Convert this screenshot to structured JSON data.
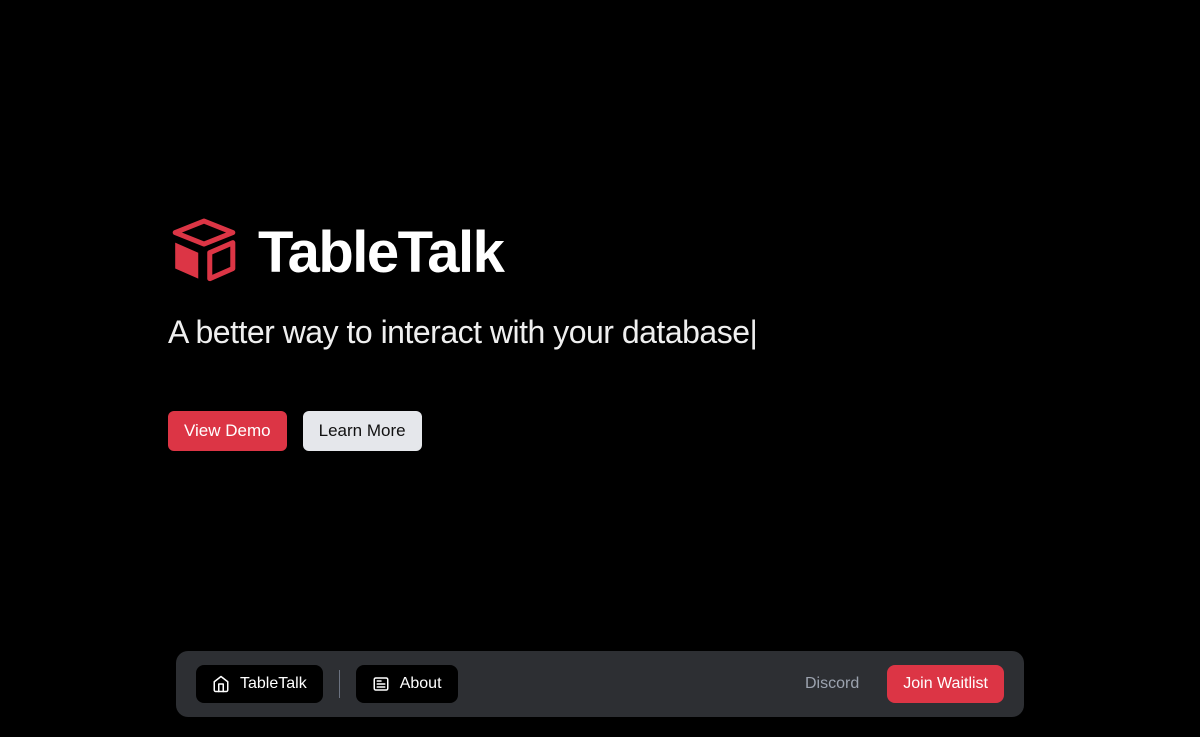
{
  "brand": {
    "name": "TableTalk",
    "accent_color": "#dc3545"
  },
  "hero": {
    "tagline": "A better way to interact with your database|",
    "cta_primary": "View Demo",
    "cta_secondary": "Learn More"
  },
  "nav": {
    "items": [
      {
        "label": "TableTalk",
        "icon": "home"
      },
      {
        "label": "About",
        "icon": "newspaper"
      }
    ],
    "link_discord": "Discord",
    "join_waitlist": "Join Waitlist"
  }
}
